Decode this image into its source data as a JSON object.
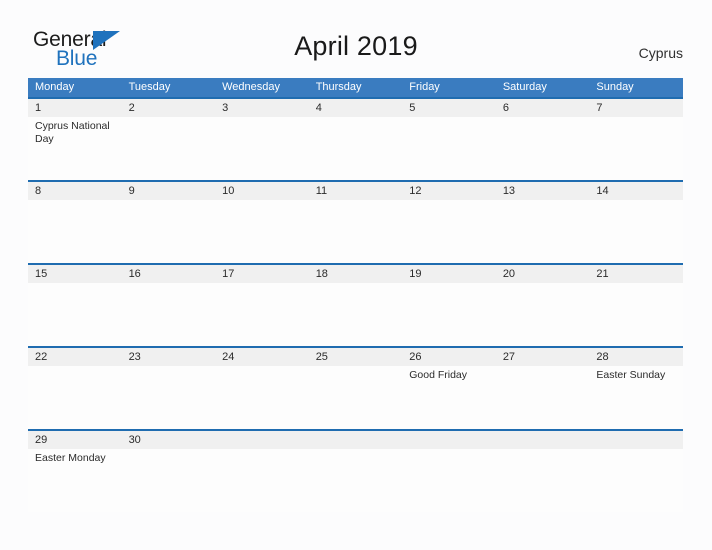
{
  "logo": {
    "word_one": "General",
    "word_two": "Blue",
    "triangle_icon": "triangle-icon",
    "accent_color": "#1f72bd"
  },
  "header": {
    "title": "April 2019",
    "country": "Cyprus"
  },
  "theme": {
    "header_band_color": "#3a7cc0",
    "divider_color": "#1f6cb0",
    "date_band_color": "#f0f0f0",
    "page_background": "#fcfcfd"
  },
  "calendar": {
    "day_names": [
      "Monday",
      "Tuesday",
      "Wednesday",
      "Thursday",
      "Friday",
      "Saturday",
      "Sunday"
    ],
    "weeks": [
      {
        "dates": [
          "1",
          "2",
          "3",
          "4",
          "5",
          "6",
          "7"
        ],
        "events": [
          "Cyprus National Day",
          "",
          "",
          "",
          "",
          "",
          ""
        ],
        "full_band": true
      },
      {
        "dates": [
          "8",
          "9",
          "10",
          "11",
          "12",
          "13",
          "14"
        ],
        "events": [
          "",
          "",
          "",
          "",
          "",
          "",
          ""
        ],
        "full_band": true
      },
      {
        "dates": [
          "15",
          "16",
          "17",
          "18",
          "19",
          "20",
          "21"
        ],
        "events": [
          "",
          "",
          "",
          "",
          "",
          "",
          ""
        ],
        "full_band": true
      },
      {
        "dates": [
          "22",
          "23",
          "24",
          "25",
          "26",
          "27",
          "28"
        ],
        "events": [
          "",
          "",
          "",
          "",
          "Good Friday",
          "",
          "Easter Sunday"
        ],
        "full_band": true
      },
      {
        "dates": [
          "29",
          "30",
          "",
          "",
          "",
          "",
          ""
        ],
        "events": [
          "Easter Monday",
          "",
          "",
          "",
          "",
          "",
          ""
        ],
        "full_band": true
      }
    ]
  }
}
